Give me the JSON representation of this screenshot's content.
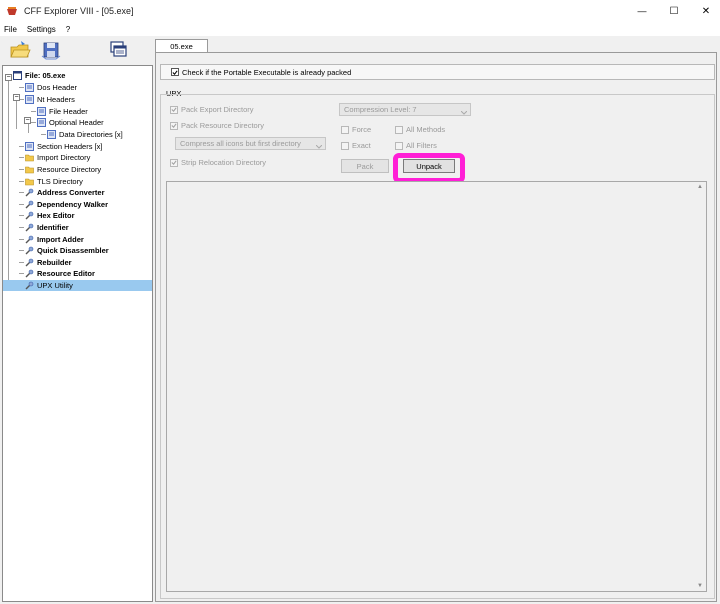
{
  "window": {
    "title": "CFF Explorer VIII - [05.exe]",
    "minimize": "—",
    "maximize": "☐",
    "close": "✕"
  },
  "menu": [
    "File",
    "Settings",
    "?"
  ],
  "toolbar": {
    "icons": [
      "open-folder-icon",
      "save-disk-icon",
      "windows-icon"
    ]
  },
  "tree": {
    "items": [
      {
        "label": "File: 05.exe",
        "bold": true,
        "icon": "window-icon"
      },
      {
        "label": "Dos Header",
        "bold": false,
        "icon": "table-icon"
      },
      {
        "label": "Nt Headers",
        "bold": false,
        "icon": "table-icon"
      },
      {
        "label": "File Header",
        "bold": false,
        "icon": "table-icon"
      },
      {
        "label": "Optional Header",
        "bold": false,
        "icon": "table-icon"
      },
      {
        "label": "Data Directories [x]",
        "bold": false,
        "icon": "table-icon"
      },
      {
        "label": "Section Headers [x]",
        "bold": false,
        "icon": "table-icon"
      },
      {
        "label": "Import Directory",
        "bold": false,
        "icon": "folder-icon"
      },
      {
        "label": "Resource Directory",
        "bold": false,
        "icon": "folder-icon"
      },
      {
        "label": "TLS Directory",
        "bold": false,
        "icon": "folder-icon"
      },
      {
        "label": "Address Converter",
        "bold": true,
        "icon": "tool-icon"
      },
      {
        "label": "Dependency Walker",
        "bold": true,
        "icon": "tool-icon"
      },
      {
        "label": "Hex Editor",
        "bold": true,
        "icon": "tool-icon"
      },
      {
        "label": "Identifier",
        "bold": true,
        "icon": "tool-icon"
      },
      {
        "label": "Import Adder",
        "bold": true,
        "icon": "tool-icon"
      },
      {
        "label": "Quick Disassembler",
        "bold": true,
        "icon": "tool-icon"
      },
      {
        "label": "Rebuilder",
        "bold": true,
        "icon": "tool-icon"
      },
      {
        "label": "Resource Editor",
        "bold": true,
        "icon": "tool-icon"
      },
      {
        "label": "UPX Utility",
        "bold": false,
        "icon": "tool-icon",
        "selected": true
      }
    ]
  },
  "tab": {
    "label": "05.exe"
  },
  "upx": {
    "already_packed_label": "Check if the Portable Executable is already packed",
    "already_packed_checked": true,
    "group_label": "UPX",
    "pack_export_label": "Pack Export Directory",
    "pack_resource_label": "Pack Resource Directory",
    "icons_option": "Compress all icons but first directory",
    "strip_reloc_label": "Strip Relocation Directory",
    "compression_level": "Compression Level: 7",
    "force_label": "Force",
    "all_methods_label": "All Methods",
    "exact_label": "Exact",
    "all_filters_label": "All Filters",
    "pack_button": "Pack",
    "unpack_button": "Unpack"
  },
  "colors": {
    "highlight": "#ff1fd6",
    "selection": "#99c9ef"
  }
}
